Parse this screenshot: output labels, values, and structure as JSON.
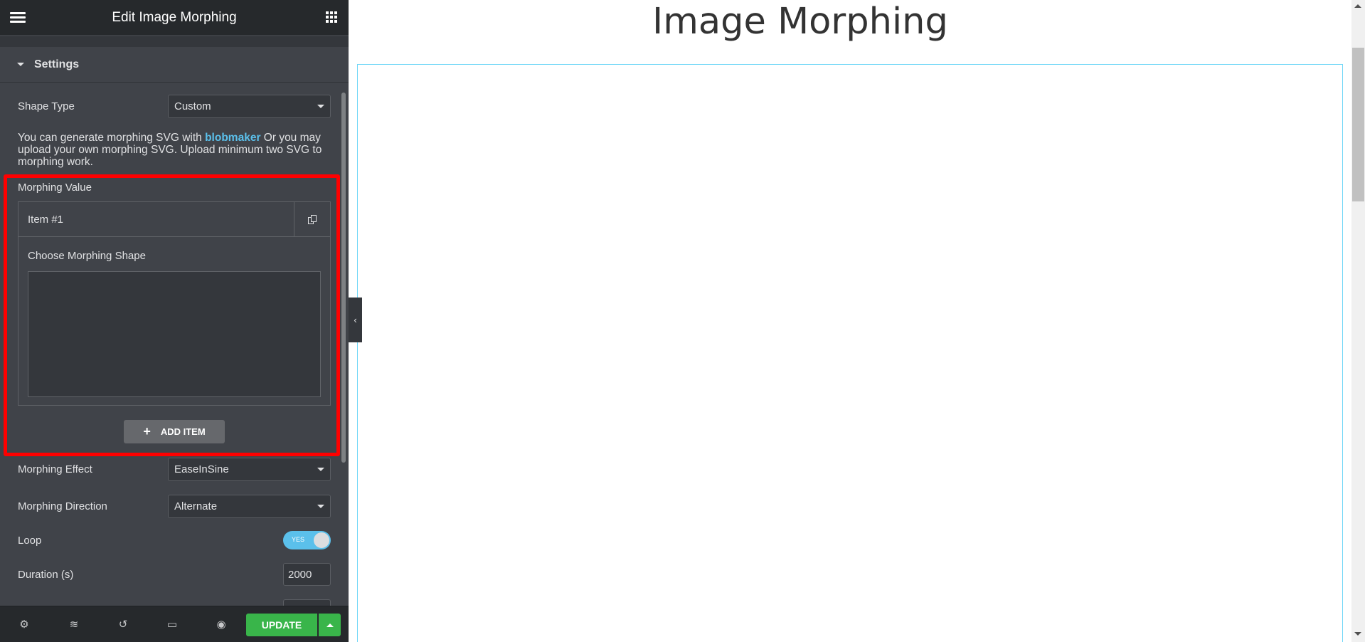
{
  "panel": {
    "title": "Edit Image Morphing",
    "section_label": "Settings",
    "shape_type": {
      "label": "Shape Type",
      "value": "Custom"
    },
    "description": {
      "before": "You can generate morphing SVG with ",
      "link": "blobmaker",
      "after": " Or you may upload your own morphing SVG. Upload minimum two SVG to morphing work."
    },
    "morphing_value": {
      "label": "Morphing Value",
      "items": [
        {
          "title": "Item #1",
          "field_label": "Choose Morphing Shape"
        }
      ],
      "add_item_label": "ADD ITEM"
    },
    "morphing_effect": {
      "label": "Morphing Effect",
      "value": "EaseInSine"
    },
    "morphing_direction": {
      "label": "Morphing Direction",
      "value": "Alternate"
    },
    "loop": {
      "label": "Loop",
      "value": "YES",
      "on": true
    },
    "duration": {
      "label": "Duration (s)",
      "value": "2000"
    }
  },
  "footer": {
    "update_label": "UPDATE",
    "icons": [
      "gear-icon",
      "layers-icon",
      "history-icon",
      "responsive-icon",
      "eye-icon"
    ]
  },
  "canvas": {
    "page_title": "Image Morphing"
  },
  "colors": {
    "accent": "#5bc0eb",
    "update": "#39b54a",
    "highlight": "#ff0000"
  }
}
